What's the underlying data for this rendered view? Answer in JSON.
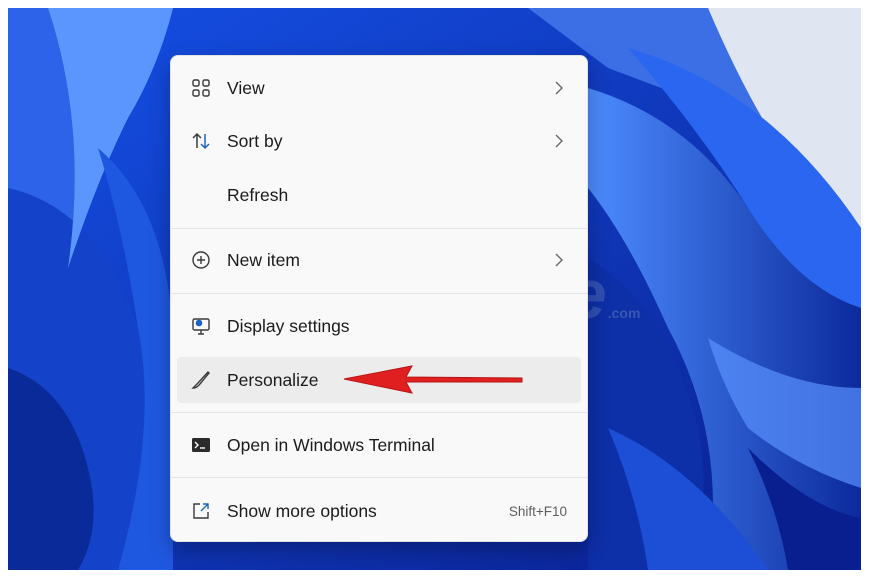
{
  "menu": {
    "items": [
      {
        "label": "View",
        "icon": "view-grid-icon",
        "has_submenu": true
      },
      {
        "label": "Sort by",
        "icon": "sort-arrows-icon",
        "has_submenu": true
      },
      {
        "label": "Refresh",
        "icon": "",
        "has_submenu": false
      },
      {
        "label": "New item",
        "icon": "plus-circle-icon",
        "has_submenu": true
      },
      {
        "label": "Display settings",
        "icon": "display-settings-icon",
        "has_submenu": false
      },
      {
        "label": "Personalize",
        "icon": "brush-icon",
        "has_submenu": false,
        "highlighted": true
      },
      {
        "label": "Open in Windows Terminal",
        "icon": "terminal-icon",
        "has_submenu": false
      },
      {
        "label": "Show more options",
        "icon": "show-more-icon",
        "has_submenu": false,
        "shortcut": "Shift+F10"
      }
    ]
  },
  "watermark": {
    "text": "TipsMake",
    "suffix": ".com"
  },
  "colors": {
    "wallpaper_dark": "#0a1f8f",
    "wallpaper_light": "#3c78ee",
    "menu_bg": "#f9f9f9",
    "highlight": "#ececec",
    "arrow": "#e02020",
    "accent_icon": "#1a63c4"
  }
}
